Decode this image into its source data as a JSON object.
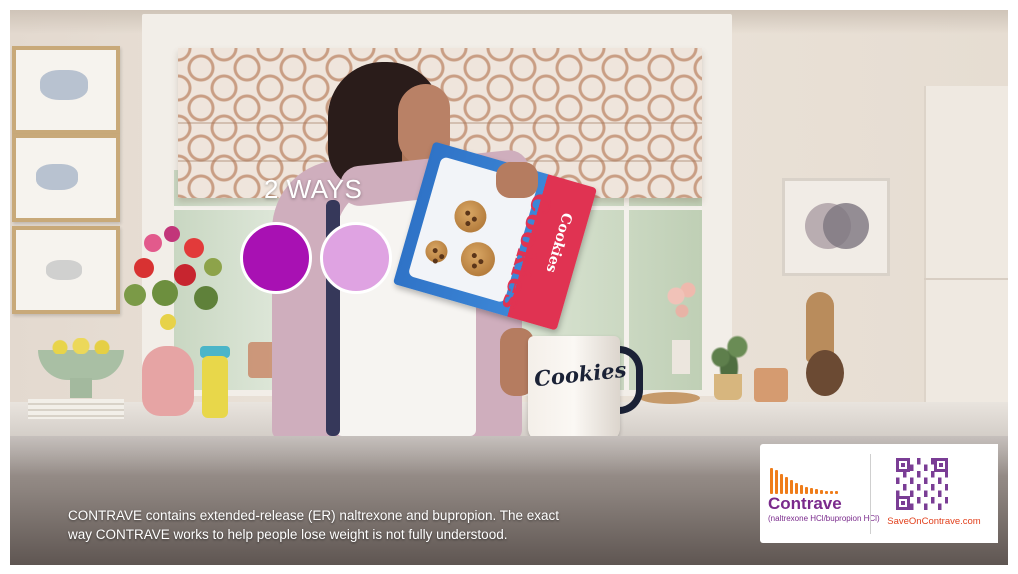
{
  "overlay": {
    "title": "2 WAYS",
    "circle_colors": [
      "#a811b3",
      "#dfa3e2"
    ]
  },
  "mug": {
    "text": "Cookies"
  },
  "cereal_box": {
    "name": "Cookies"
  },
  "disclaimer": {
    "line1": "CONTRAVE contains extended-release (ER) naltrexone and bupropion. The exact",
    "line2": "way CONTRAVE works to help people lose weight is not fully understood."
  },
  "brand": {
    "name": "Contrave",
    "generic": "(naltrexone HCl/bupropion HCl)",
    "url": "SaveOnContrave.com",
    "colors": {
      "purple": "#7a2a8c",
      "orange": "#ef7d1a",
      "url_red": "#e2411d"
    }
  }
}
